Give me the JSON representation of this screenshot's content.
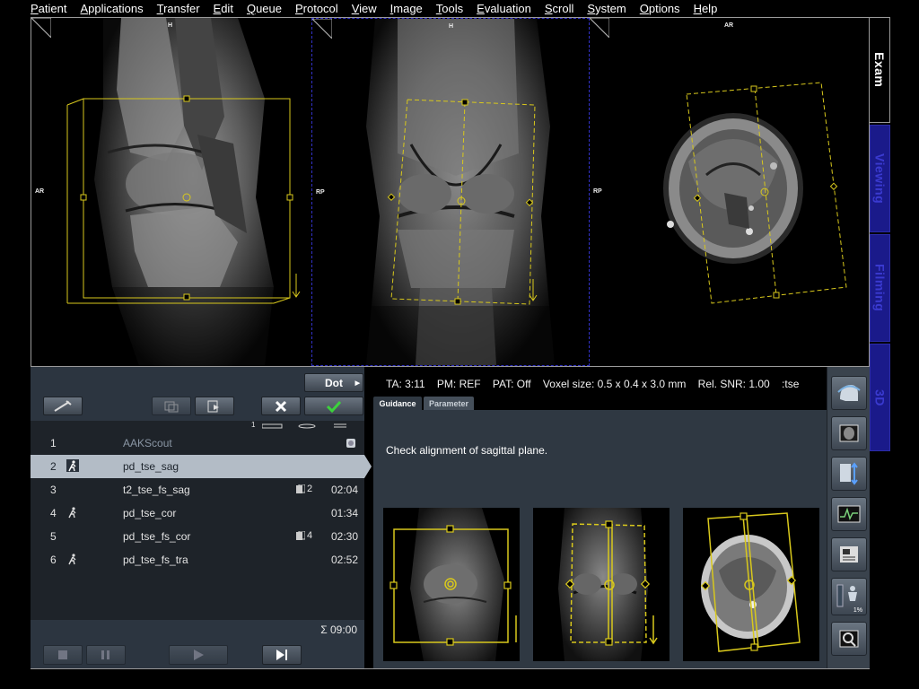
{
  "menu": [
    "Patient",
    "Applications",
    "Transfer",
    "Edit",
    "Queue",
    "Protocol",
    "View",
    "Image",
    "Tools",
    "Evaluation",
    "Scroll",
    "System",
    "Options",
    "Help"
  ],
  "viewer": {
    "seg1": {
      "top": "H",
      "left": "AR"
    },
    "seg2": {
      "top": "H",
      "left": "RP"
    },
    "seg3": {
      "top": "AR",
      "left": "RP"
    }
  },
  "side_tabs": [
    {
      "label": "Exam",
      "active": true
    },
    {
      "label": "Viewing",
      "active": false
    },
    {
      "label": "Filming",
      "active": false
    },
    {
      "label": "3D",
      "active": false
    }
  ],
  "program": {
    "dot_label": "Dot",
    "list_header_count": "1",
    "rows": [
      {
        "num": "1",
        "name": "AAKScout",
        "count": "",
        "duration": ""
      },
      {
        "num": "2",
        "name": "pd_tse_sag",
        "count": "",
        "duration": ""
      },
      {
        "num": "3",
        "name": "t2_tse_fs_sag",
        "count": "2",
        "duration": "02:04"
      },
      {
        "num": "4",
        "name": "pd_tse_cor",
        "count": "",
        "duration": "01:34"
      },
      {
        "num": "5",
        "name": "pd_tse_fs_cor",
        "count": "4",
        "duration": "02:30"
      },
      {
        "num": "6",
        "name": "pd_tse_fs_tra",
        "count": "",
        "duration": "02:52"
      }
    ],
    "total": "Σ 09:00"
  },
  "info_bar": "TA: 3:11    PM: REF    PAT: Off    Voxel size: 0.5 x 0.4 x 3.0 mm    Rel. SNR: 1.00    :tse",
  "guidance": {
    "tabs": [
      "Guidance",
      "Parameter"
    ],
    "text": "Check alignment of sagittal plane."
  },
  "tools": [
    "head-coil-icon",
    "localizer-icon",
    "table-move-icon",
    "physio-icon",
    "protocol-editor-icon",
    "patient-position-icon",
    "search-zoom-icon"
  ],
  "tool_percent": "1%",
  "colors": {
    "accent_yellow": "#d8c81c",
    "tab_blue": "#1a1a8a",
    "panel": "#2c3540",
    "selected_row": "#b3bcc6"
  }
}
